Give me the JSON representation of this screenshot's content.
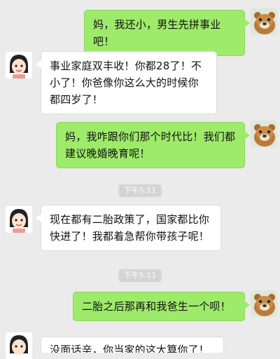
{
  "messages": [
    {
      "sender": "self",
      "text": "妈，我还小，男生先拼事业吧！"
    },
    {
      "sender": "other",
      "text": "事业家庭双丰收！你都28了！不小了！你爸像你这么大的时候你都四岁了！"
    },
    {
      "sender": "self",
      "text": "妈，我咋跟你们那个时代比！我们都建议晚婚晚育呢！"
    },
    {
      "sender": "other",
      "text": "现在都有二胎政策了，国家都比你快进了！我都着急帮你带孩子呢！"
    },
    {
      "sender": "self",
      "text": "二胎之后那再和我爸生一个呗！"
    },
    {
      "sender": "other",
      "text": "没面话辛，你当家的这大算你了！"
    }
  ],
  "timestamps": [
    "下午5:11",
    "下午5:11"
  ],
  "icons": {
    "self_avatar": "cartoon-bear-avatar-icon",
    "other_avatar": "cartoon-mother-avatar-icon"
  },
  "colors": {
    "background": "#ebebeb",
    "self_bubble": "#9eea6a",
    "other_bubble": "#ffffff",
    "timestamp_bg": "#d4d4d4"
  }
}
